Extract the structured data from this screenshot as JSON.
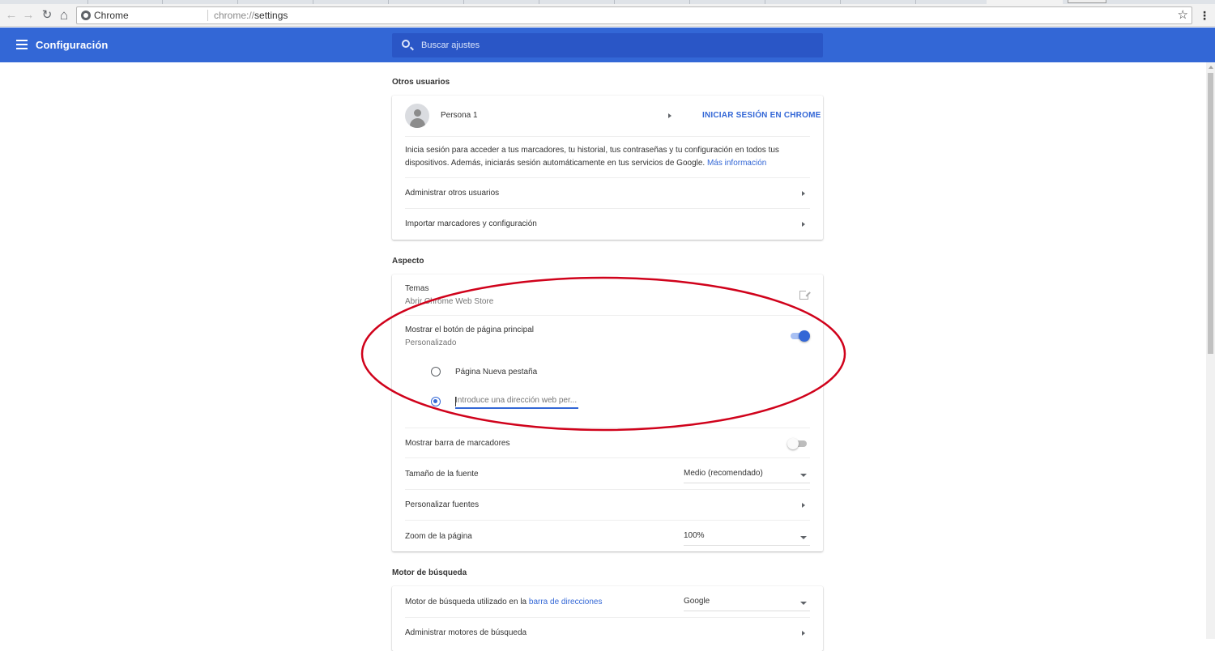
{
  "browser": {
    "site_name": "Chrome",
    "url_scheme": "chrome://",
    "url_path": "settings",
    "back_glyph": "←",
    "forward_glyph": "→",
    "reload_glyph": "↻",
    "home_glyph": "⌂",
    "star_glyph": "☆",
    "menu_glyph": "⋮"
  },
  "header": {
    "title": "Configuración",
    "search_placeholder": "Buscar ajustes"
  },
  "people": {
    "section_title": "Otros usuarios",
    "profile_name": "Persona 1",
    "sign_in_button": "INICIAR SESIÓN EN CHROME",
    "sign_in_text": "Inicia sesión para acceder a tus marcadores, tu historial, tus contraseñas y tu configuración en todos tus dispositivos. Además, iniciarás sesión automáticamente en tus servicios de Google.",
    "learn_more": "Más información",
    "manage_users": "Administrar otros usuarios",
    "import_bookmarks": "Importar marcadores y configuración"
  },
  "appearance": {
    "section_title": "Aspecto",
    "themes_label": "Temas",
    "themes_sub": "Abrir Chrome Web Store",
    "home_button_label": "Mostrar el botón de página principal",
    "home_button_sub": "Personalizado",
    "home_button_enabled": true,
    "radio_new_tab": "Página Nueva pestaña",
    "custom_url_placeholder": "Introduce una dirección web per...",
    "custom_url_value": "",
    "bookmarks_bar_label": "Mostrar barra de marcadores",
    "bookmarks_bar_enabled": false,
    "font_size_label": "Tamaño de la fuente",
    "font_size_value": "Medio (recomendado)",
    "customize_fonts": "Personalizar fuentes",
    "page_zoom_label": "Zoom de la página",
    "page_zoom_value": "100%"
  },
  "search_engine": {
    "section_title": "Motor de búsqueda",
    "engine_label_prefix": "Motor de búsqueda utilizado en la ",
    "engine_label_link": "barra de direcciones",
    "engine_value": "Google",
    "manage_engines": "Administrar motores de búsqueda"
  },
  "colors": {
    "accent": "#3367d6",
    "header_bg": "#3367d6",
    "annotation_ellipse": "#d0021b"
  }
}
